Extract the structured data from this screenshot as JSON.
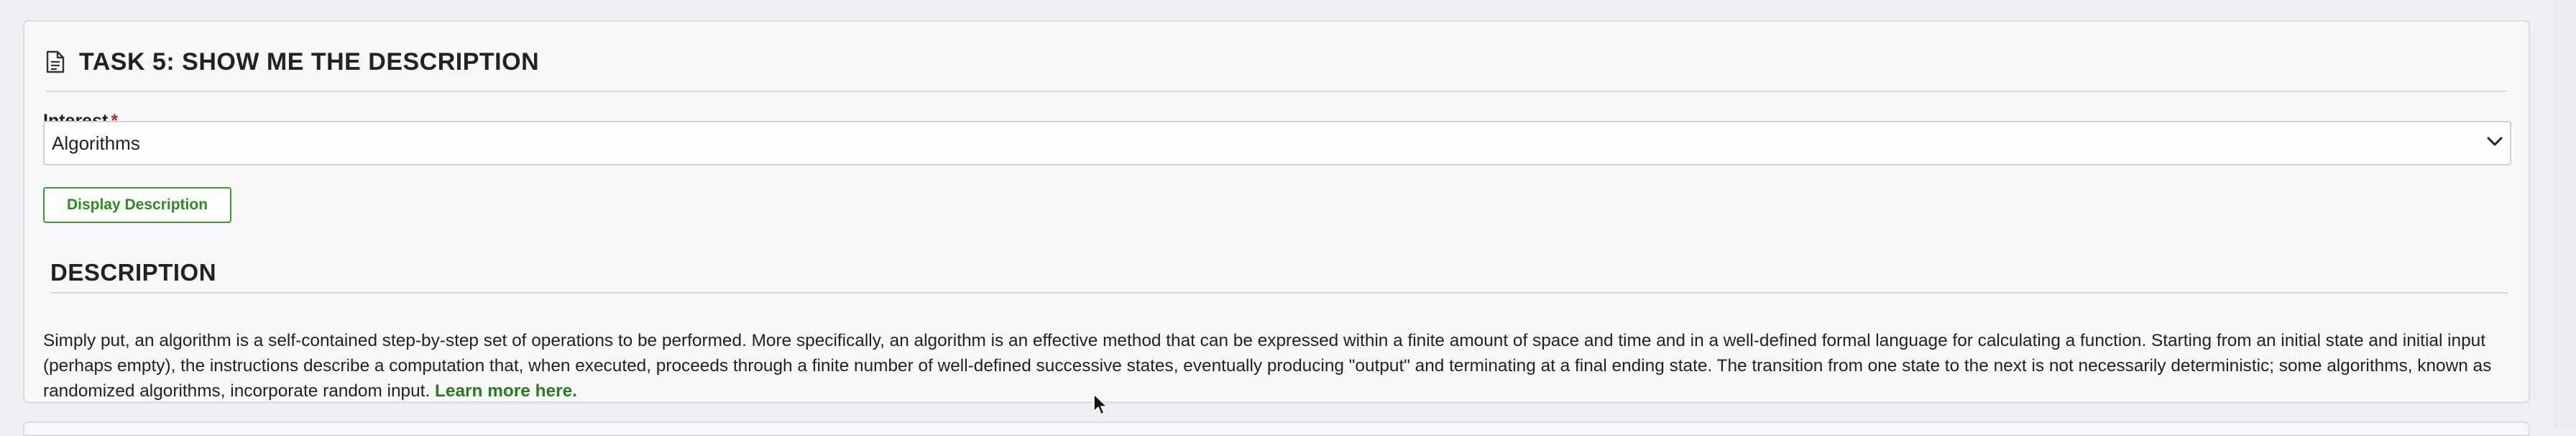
{
  "task": {
    "title": "TASK 5: SHOW ME THE DESCRIPTION",
    "icon": "document-icon"
  },
  "form": {
    "interest_label": "Interest",
    "required_marker": "*",
    "interest_selected": "Algorithms",
    "display_button_label": "Display Description"
  },
  "description": {
    "heading": "DESCRIPTION",
    "text": "Simply put, an algorithm is a self-contained step-by-step set of operations to be performed. More specifically, an algorithm is an effective method that can be expressed within a finite amount of space and time and in a well-defined formal language for calculating a function. Starting from an initial state and initial input (perhaps empty), the instructions describe a computation that, when executed, proceeds through a finite number of well-defined successive states, eventually producing \"output\" and terminating at a final ending state. The transition from one state to the next is not necessarily deterministic; some algorithms, known as randomized algorithms, incorporate random input.",
    "link_text": "Learn more here."
  },
  "colors": {
    "accent_green": "#2f8a22",
    "required_red": "#c62828",
    "page_background": "#efeff3",
    "card_background": "#f8f8fb"
  }
}
